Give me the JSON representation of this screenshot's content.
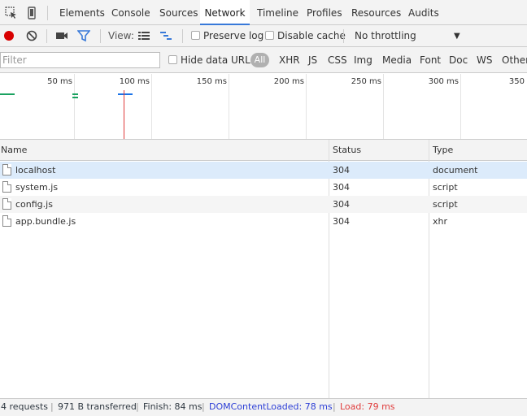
{
  "tabs": [
    "Elements",
    "Console",
    "Sources",
    "Network",
    "Timeline",
    "Profiles",
    "Resources",
    "Audits"
  ],
  "active_tab": "Network",
  "toolbar": {
    "view_label": "View:",
    "preserve_log": "Preserve log",
    "disable_cache": "Disable cache",
    "throttling": "No throttling",
    "record_color": "#d80000",
    "filter_icon_color": "#3879d9"
  },
  "filterbar": {
    "placeholder": "Filter",
    "hide_data_urls": "Hide data URLs",
    "types": [
      "All",
      "XHR",
      "JS",
      "CSS",
      "Img",
      "Media",
      "Font",
      "Doc",
      "WS",
      "Other"
    ]
  },
  "overview": {
    "ticks": [
      "50 ms",
      "100 ms",
      "150 ms",
      "200 ms",
      "250 ms",
      "300 ms",
      "350"
    ]
  },
  "table": {
    "columns": [
      "Name",
      "Status",
      "Type"
    ],
    "rows": [
      {
        "name": "localhost",
        "status": "304",
        "type": "document"
      },
      {
        "name": "system.js",
        "status": "304",
        "type": "script"
      },
      {
        "name": "config.js",
        "status": "304",
        "type": "script"
      },
      {
        "name": "app.bundle.js",
        "status": "304",
        "type": "xhr"
      }
    ]
  },
  "statusbar": {
    "requests": "4 requests",
    "transferred": "971 B transferred",
    "finish": "Finish: 84 ms",
    "dom_content_loaded": "DOMContentLoaded: 78 ms",
    "load": "Load: 79 ms",
    "dcl_color": "#2d3fd6",
    "load_color": "#e03c3c"
  }
}
